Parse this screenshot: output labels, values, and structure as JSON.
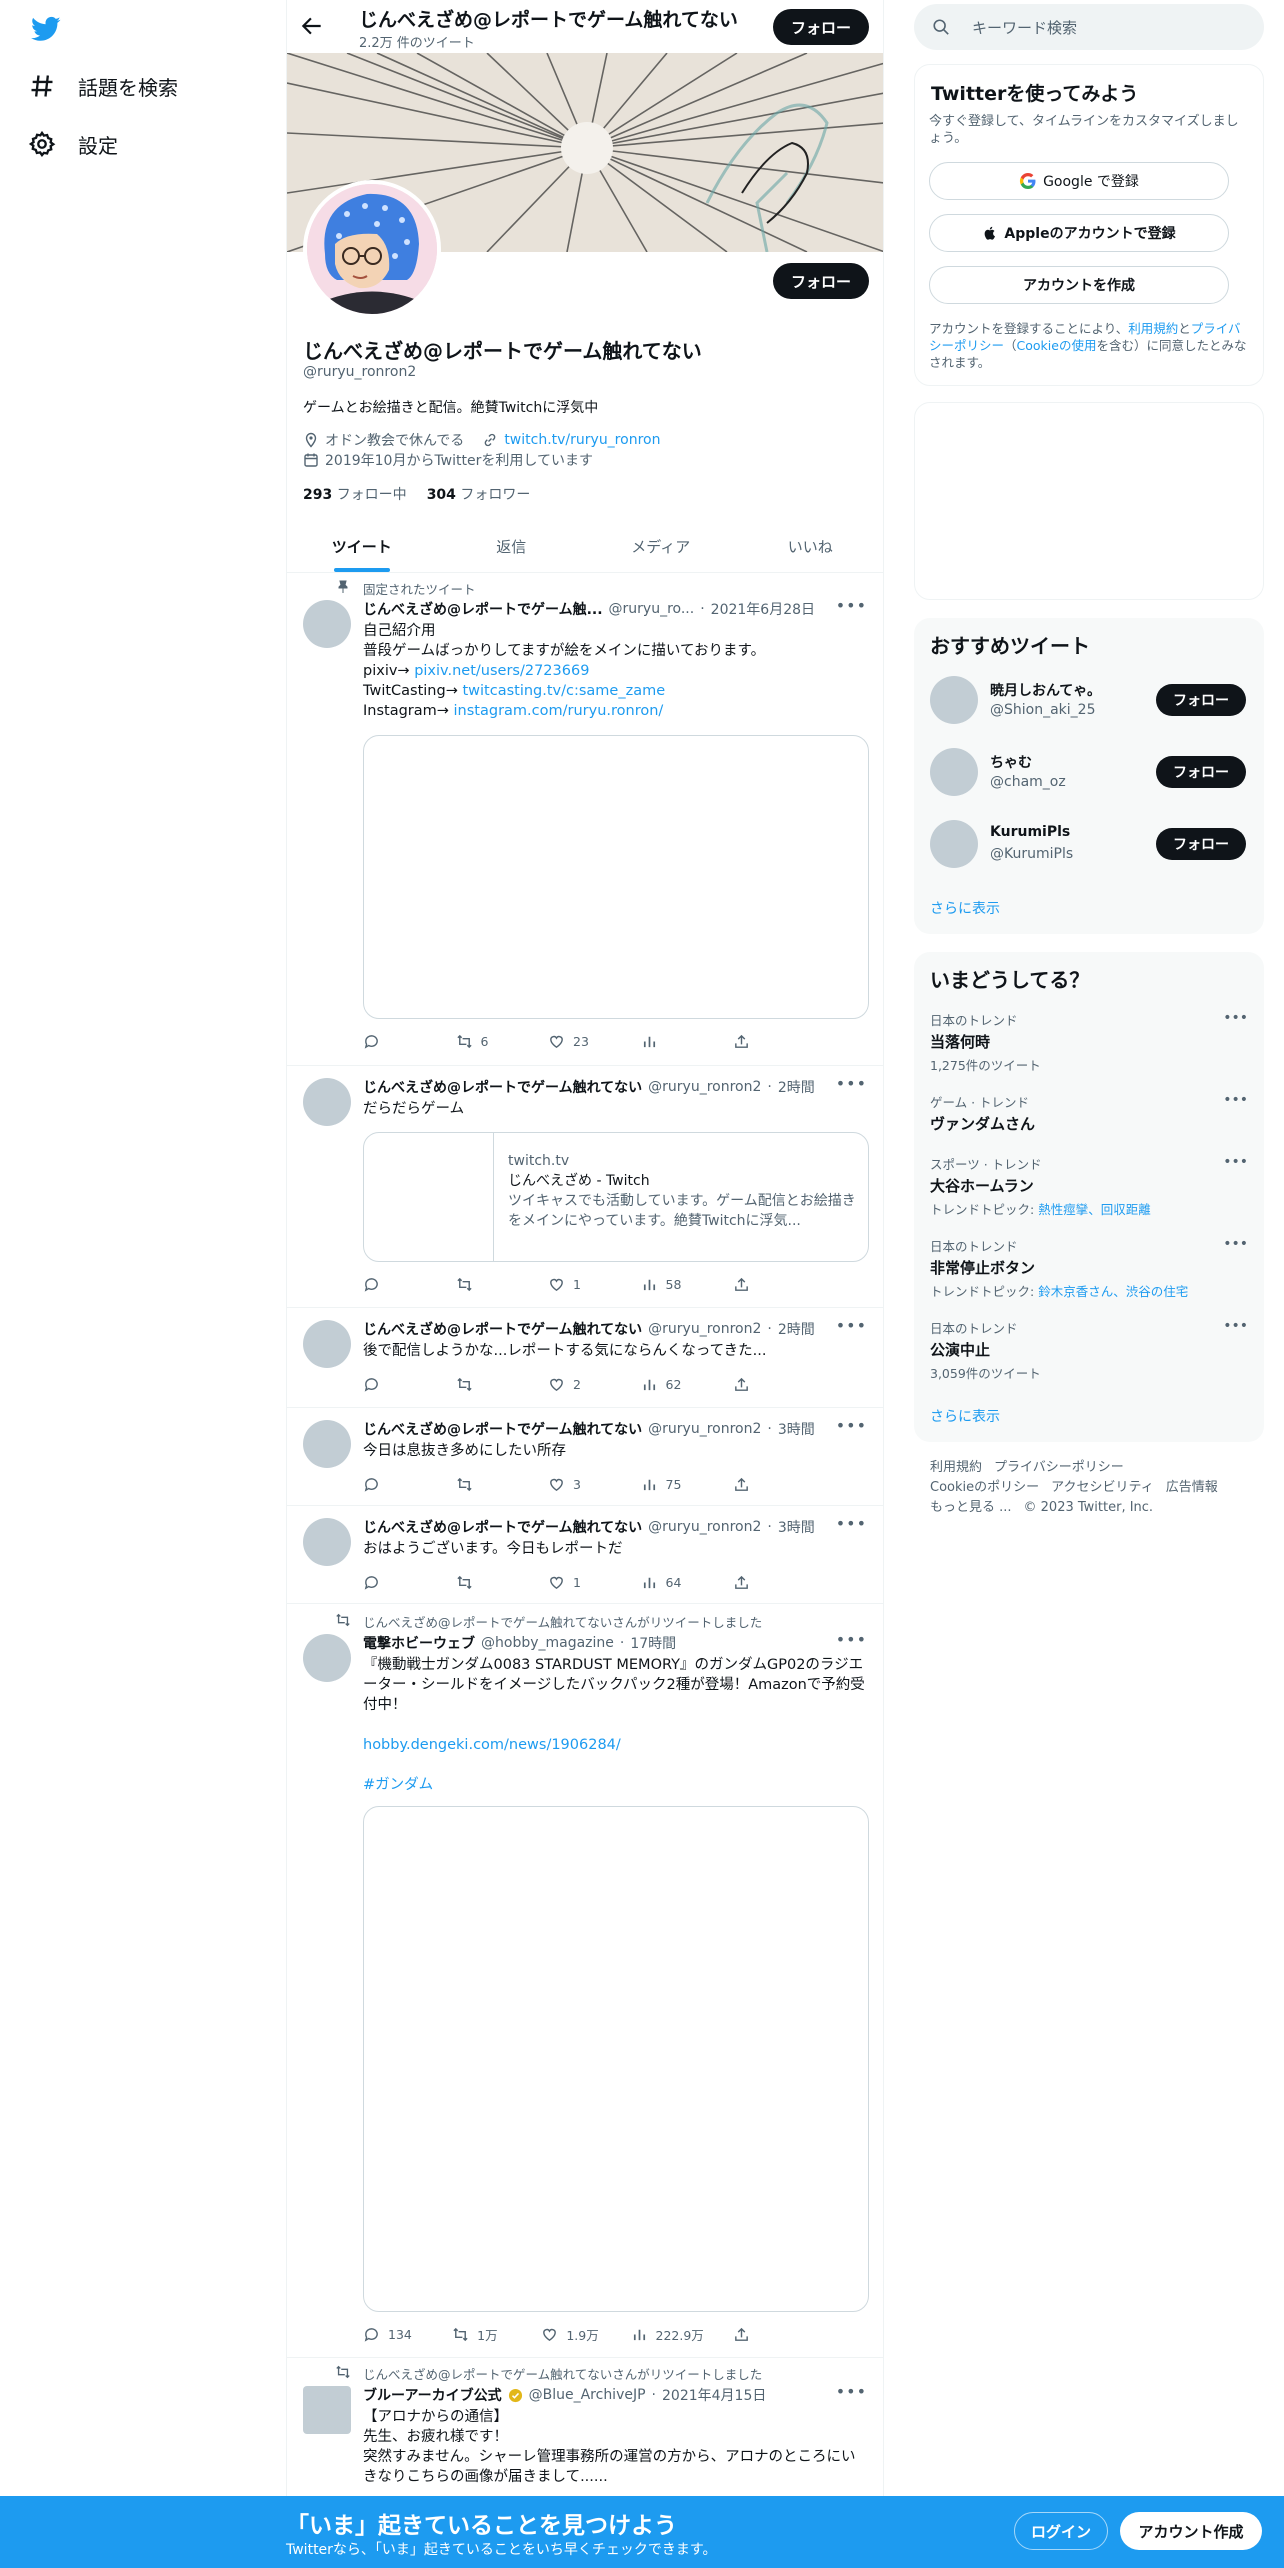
{
  "nav": {
    "explore": "話題を検索",
    "settings": "設定"
  },
  "header": {
    "name": "じんべえざめ@レポートでゲーム触れてない",
    "tweet_count": "2.2万 件のツイート",
    "follow": "フォロー"
  },
  "profile": {
    "name": "じんべえざめ@レポートでゲーム触れてない",
    "handle": "@ruryu_ronron2",
    "bio": "ゲームとお絵描きと配信。絶賛Twitchに浮気中",
    "location": "オドン教会で休んでる",
    "link": "twitch.tv/ruryu_ronron",
    "joined": "2019年10月からTwitterを利用しています",
    "following_count": "293",
    "following_label": "フォロー中",
    "followers_count": "304",
    "followers_label": "フォロワー",
    "follow": "フォロー"
  },
  "tabs": [
    "ツイート",
    "返信",
    "メディア",
    "いいね"
  ],
  "tweets": [
    {
      "context": "固定されたツイート",
      "name": "じんべえざめ@レポートでゲーム触...",
      "handle": "@ruryu_ro...",
      "time": "2021年6月28日",
      "lines": [
        "自己紹介用",
        "普段ゲームばっかりしてますが絵をメインに描いております。"
      ],
      "pixiv_label": "pixiv→ ",
      "pixiv_link": "pixiv.net/users/2723669",
      "twitcasting_label": "TwitCasting→ ",
      "twitcasting_link": "twitcasting.tv/c:same_zame",
      "instagram_label": "Instagram→ ",
      "instagram_link": "instagram.com/ruryu.ronron/",
      "replies": "",
      "retweets": "6",
      "likes": "23",
      "views": ""
    },
    {
      "name": "じんべえざめ@レポートでゲーム触れてない",
      "handle": "@ruryu_ronron2",
      "time": "2時間",
      "text": "だらだらゲーム",
      "card_domain": "twitch.tv",
      "card_title": "じんべえざめ - Twitch",
      "card_desc": "ツイキャスでも活動しています。ゲーム配信とお絵描きをメインにやっています。絶賛Twitchに浮気...",
      "replies": "",
      "retweets": "",
      "likes": "1",
      "views": "58"
    },
    {
      "name": "じんべえざめ@レポートでゲーム触れてない",
      "handle": "@ruryu_ronron2",
      "time": "2時間",
      "text": "後で配信しようかな...レポートする気にならんくなってきた...",
      "replies": "",
      "retweets": "",
      "likes": "2",
      "views": "62"
    },
    {
      "name": "じんべえざめ@レポートでゲーム触れてない",
      "handle": "@ruryu_ronron2",
      "time": "3時間",
      "text": "今日は息抜き多めにしたい所存",
      "replies": "",
      "retweets": "",
      "likes": "3",
      "views": "75"
    },
    {
      "name": "じんべえざめ@レポートでゲーム触れてない",
      "handle": "@ruryu_ronron2",
      "time": "3時間",
      "text": "おはようございます。今日もレポートだ",
      "replies": "",
      "retweets": "",
      "likes": "1",
      "views": "64"
    },
    {
      "context": "じんべえざめ@レポートでゲーム触れてないさんがリツイートしました",
      "name": "電撃ホビーウェブ",
      "handle": "@hobby_magazine",
      "time": "17時間",
      "text": "『機動戦士ガンダム0083 STARDUST MEMORY』のガンダムGP02のラジエーター・シールドをイメージしたバックパック2種が登場！Amazonで予約受付中！",
      "link": "hobby.dengeki.com/news/1906284/",
      "hashtag": "#ガンダム",
      "replies": "134",
      "retweets": "1万",
      "likes": "1.9万",
      "views": "222.9万"
    },
    {
      "context": "じんべえざめ@レポートでゲーム触れてないさんがリツイートしました",
      "name": "ブルーアーカイブ公式",
      "handle": "@Blue_ArchiveJP",
      "time": "2021年4月15日",
      "lines": [
        "【アロナからの通信】",
        "先生、お疲れ様です！",
        "突然すみません。シャーレ管理事務所の運営の方から、アロナのところにいきなりこちらの画像が届きまして......"
      ]
    }
  ],
  "sidebar": {
    "search_placeholder": "キーワード検索",
    "signup": {
      "title": "Twitterを使ってみよう",
      "desc": "今すぐ登録して、タイムラインをカスタマイズしましょう。",
      "google": "Google で登録",
      "apple": "Appleのアカウントで登録",
      "create": "アカウントを作成",
      "terms_prefix": "アカウントを登録することにより、",
      "terms_link": "利用規約",
      "terms_and": "と",
      "privacy_link": "プライバシーポリシー",
      "cookie_open": "（",
      "cookie_link": "Cookieの使用",
      "terms_suffix": "を含む）に同意したとみなされます。"
    },
    "recommended": {
      "title": "おすすめツイート",
      "users": [
        {
          "name": "暁月しおんてゃ。",
          "handle": "@Shion_aki_25"
        },
        {
          "name": "ちゃむ",
          "handle": "@cham_oz"
        },
        {
          "name": "KurumiPls",
          "handle": "@KurumiPls"
        }
      ],
      "follow": "フォロー",
      "more": "さらに表示"
    },
    "trends": {
      "title": "いまどうしてる？",
      "items": [
        {
          "category": "日本のトレンド",
          "name": "当落何時",
          "sub": "1,275件のツイート"
        },
        {
          "category": "ゲーム · トレンド",
          "name": "ヴァンダムさん",
          "sub": ""
        },
        {
          "category": "スポーツ · トレンド",
          "name": "大谷ホームラン",
          "sub_prefix": "トレンドトピック: ",
          "sub_links": "熱性痙攣、回収距離"
        },
        {
          "category": "日本のトレンド",
          "name": "非常停止ボタン",
          "sub_prefix": "トレンドトピック: ",
          "sub_links": "鈴木京香さん、渋谷の住宅"
        },
        {
          "category": "日本のトレンド",
          "name": "公演中止",
          "sub": "3,059件のツイート"
        }
      ],
      "more": "さらに表示"
    },
    "footer": {
      "terms": "利用規約",
      "privacy": "プライバシーポリシー",
      "cookie": "Cookieのポリシー",
      "accessibility": "アクセシビリティ",
      "ads": "広告情報",
      "more": "もっと見る ...",
      "copyright": "© 2023 Twitter, Inc."
    }
  },
  "bottom": {
    "title": "「いま」起きていることを見つけよう",
    "subtitle": "Twitterなら、「いま」起きていることをいち早くチェックできます。",
    "login": "ログイン",
    "signup": "アカウント作成"
  },
  "colors": {
    "accent": "#1d9bf0",
    "dark_button": "#0f1419",
    "muted_text": "#536471"
  }
}
